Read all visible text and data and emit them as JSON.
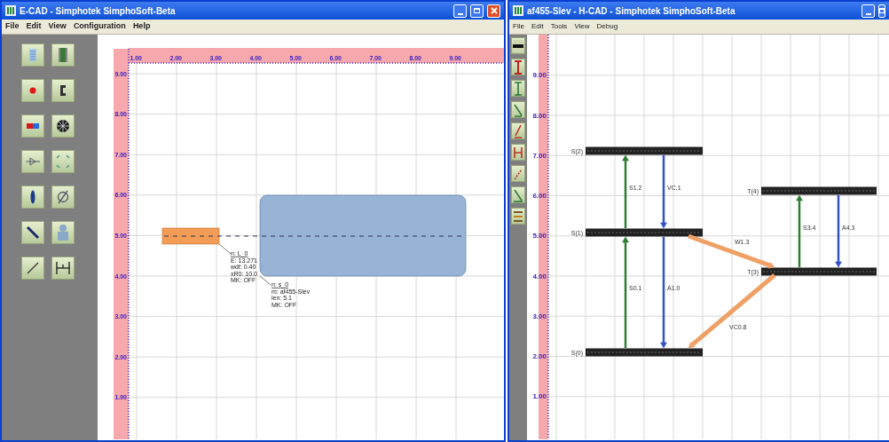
{
  "windows": [
    {
      "title": "E-CAD - Simphotek SimphoSoft-Beta",
      "menu": [
        "File",
        "Edit",
        "View",
        "Configuration",
        "Help"
      ],
      "canvas": {
        "x_ticks": [
          "1.00",
          "2.00",
          "3.00",
          "4.00",
          "5.00",
          "6.00",
          "7.00",
          "8.00",
          "9.00"
        ],
        "y_ticks": [
          "9.00",
          "8.00",
          "7.00",
          "6.00",
          "5.00",
          "4.00",
          "3.00",
          "2.00",
          "1.00"
        ],
        "shapes": [
          {
            "kind": "bar",
            "color": "#f39c55"
          },
          {
            "kind": "panel",
            "color": "#97b4d6"
          }
        ],
        "callouts": [
          {
            "name": "n: L_0",
            "lines": [
              "E: 13.271",
              "wdt: 0.40",
              "xR0: 10.0",
              "MK: OFF"
            ]
          },
          {
            "name": "n: s_0",
            "lines": [
              "m: af455-Slev",
              "len: 5.1",
              "MK: OFF"
            ]
          }
        ]
      }
    },
    {
      "title": "af455-Slev - H-CAD - Simphotek SimphoSoft-Beta",
      "menu": [
        "File",
        "Edit",
        "Tools",
        "View",
        "Debug"
      ],
      "canvas": {
        "y_ticks": [
          "9.00",
          "8.00",
          "7.00",
          "6.00",
          "5.00",
          "4.00",
          "3.00",
          "2.00",
          "1.00"
        ],
        "levels": [
          {
            "label": "S(2)"
          },
          {
            "label": "S(1)"
          },
          {
            "label": "S(0)"
          },
          {
            "label": "T(4)"
          },
          {
            "label": "T(3)"
          }
        ],
        "transitions": [
          {
            "label": "S1.2",
            "color": "#2e7d32"
          },
          {
            "label": "VC.1",
            "color": "#3451c6"
          },
          {
            "label": "S0.1",
            "color": "#2e7d32"
          },
          {
            "label": "A1.0",
            "color": "#3451c6"
          },
          {
            "label": "S3.4",
            "color": "#2e7d32"
          },
          {
            "label": "A4.3",
            "color": "#3451c6"
          },
          {
            "label": "W1.3",
            "color": "#eea066"
          },
          {
            "label": "VC0.8",
            "color": "#eea066"
          }
        ]
      }
    }
  ]
}
